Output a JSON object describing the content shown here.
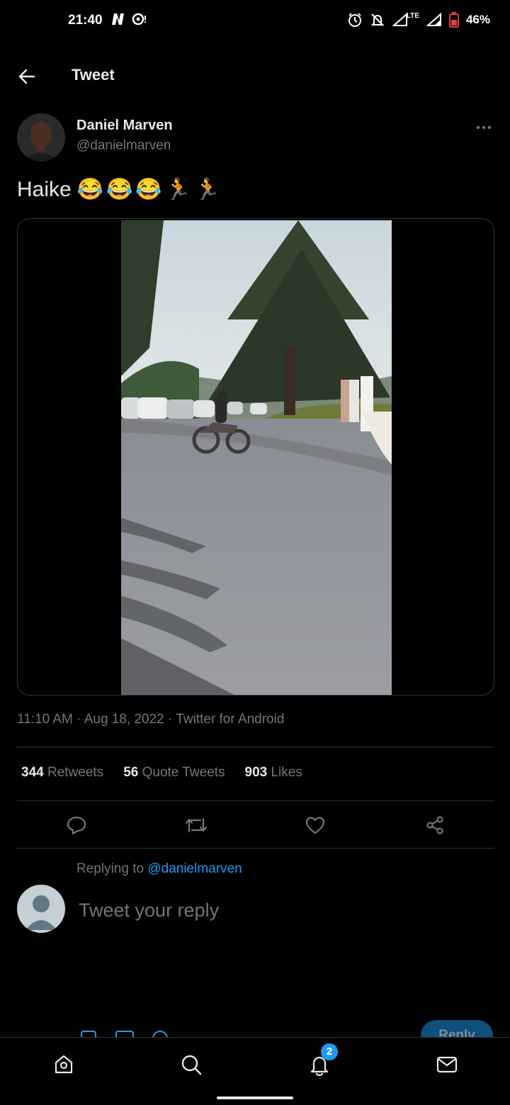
{
  "status_bar": {
    "time": "21:40",
    "battery": "46%",
    "network": "LTE",
    "icons": [
      "netflix-n-icon",
      "notification-dot-icon",
      "alarm-icon",
      "mute-icon",
      "signal-icon",
      "signal-icon",
      "battery-icon"
    ]
  },
  "header": {
    "title": "Tweet",
    "back_icon": "arrow-left-icon"
  },
  "tweet": {
    "author_name": "Daniel Marven",
    "author_handle": "@danielmarven",
    "text": "Haike",
    "emojis": [
      "😂",
      "😂",
      "😂",
      "🏃",
      "🏃"
    ],
    "more_icon": "ellipsis-icon",
    "timestamp": "11:10 AM · Aug 18, 2022 · Twitter for Android"
  },
  "stats": [
    {
      "count": "344",
      "label": "Retweets"
    },
    {
      "count": "56",
      "label": "Quote Tweets"
    },
    {
      "count": "903",
      "label": "Likes"
    }
  ],
  "actions": [
    "reply-icon",
    "retweet-icon",
    "like-icon",
    "share-icon"
  ],
  "reply": {
    "replying_prefix": "Replying to ",
    "replying_to": "@danielmarven",
    "placeholder": "Tweet your reply",
    "button_label": "Reply"
  },
  "bottom_nav": {
    "items": [
      "home-icon",
      "search-icon",
      "notifications-icon",
      "messages-icon"
    ],
    "notification_count": "2"
  },
  "colors": {
    "background": "#000000",
    "text": "#e7e9ea",
    "muted": "#71767b",
    "accent": "#1d9bf0",
    "divider": "#2f3336"
  }
}
